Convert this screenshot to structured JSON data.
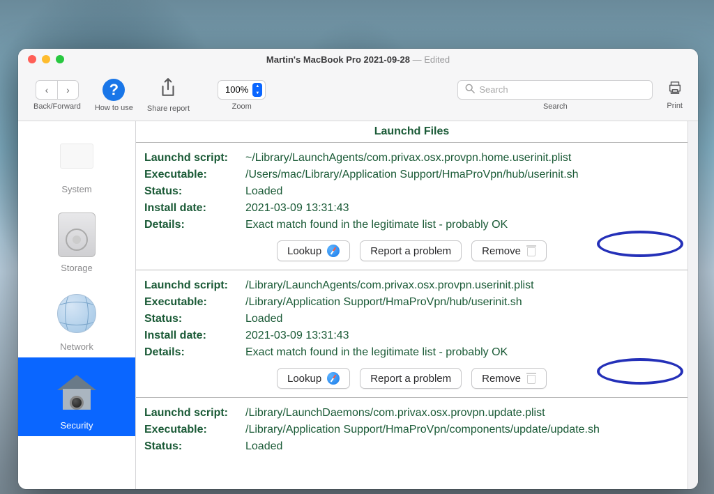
{
  "window": {
    "title": "Martin's MacBook Pro 2021-09-28",
    "edited": " — Edited"
  },
  "toolbar": {
    "back_forward": "Back/Forward",
    "how_to_use": "How to use",
    "share_report": "Share report",
    "zoom": "Zoom",
    "zoom_value": "100%",
    "search": "Search",
    "search_placeholder": "Search",
    "print": "Print"
  },
  "sidebar": {
    "items": [
      {
        "label": "System"
      },
      {
        "label": "Storage"
      },
      {
        "label": "Network"
      },
      {
        "label": "Security"
      }
    ]
  },
  "section_title": "Launchd Files",
  "row_labels": {
    "script": "Launchd script:",
    "executable": "Executable:",
    "status": "Status:",
    "install_date": "Install date:",
    "details": "Details:"
  },
  "buttons": {
    "lookup": "Lookup",
    "report": "Report a problem",
    "remove": "Remove"
  },
  "entries": [
    {
      "script": "~/Library/LaunchAgents/com.privax.osx.provpn.home.userinit.plist",
      "executable": "/Users/mac/Library/Application Support/HmaProVpn/hub/userinit.sh",
      "status": "Loaded",
      "install_date": "2021-03-09 13:31:43",
      "details": "Exact match found in the legitimate list - probably OK"
    },
    {
      "script": "/Library/LaunchAgents/com.privax.osx.provpn.userinit.plist",
      "executable": "/Library/Application Support/HmaProVpn/hub/userinit.sh",
      "status": "Loaded",
      "install_date": "2021-03-09 13:31:43",
      "details": "Exact match found in the legitimate list - probably OK"
    },
    {
      "script": "/Library/LaunchDaemons/com.privax.osx.provpn.update.plist",
      "executable": "/Library/Application Support/HmaProVpn/components/update/update.sh",
      "status": "Loaded",
      "install_date": "",
      "details": ""
    }
  ]
}
